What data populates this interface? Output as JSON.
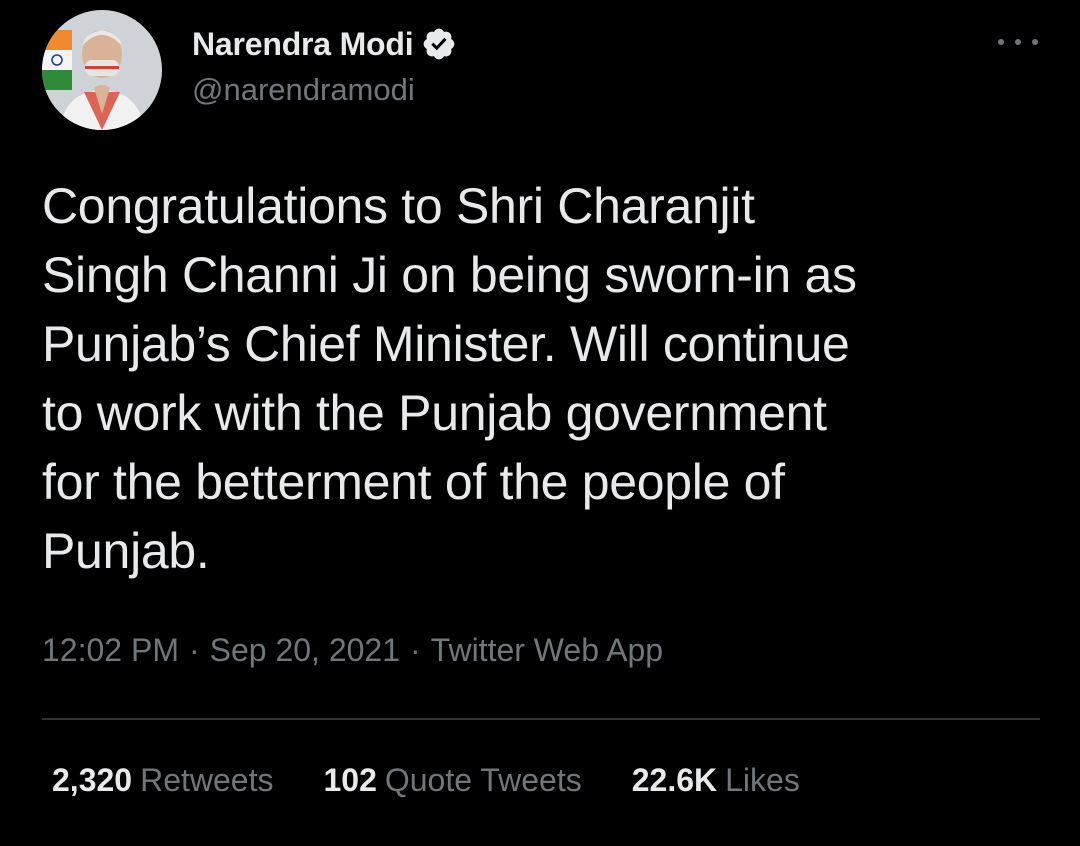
{
  "author": {
    "display_name": "Narendra Modi",
    "handle": "@narendramodi",
    "verified_icon": "verified-badge-icon",
    "avatar": "profile-photo"
  },
  "menu": {
    "icon": "more-options-icon"
  },
  "tweet": {
    "text": "Congratulations to Shri Charanjit\nSingh Channi Ji on being sworn-in as\nPunjab’s Chief Minister. Will continue\nto work with the Punjab government\nfor the betterment of the people of\nPunjab."
  },
  "meta": {
    "time": "12:02 PM",
    "separator": "·",
    "date": "Sep 20, 2021",
    "source": "Twitter Web App"
  },
  "stats": {
    "retweets_count": "2,320",
    "retweets_label": "Retweets",
    "quotes_count": "102",
    "quotes_label": "Quote Tweets",
    "likes_count": "22.6K",
    "likes_label": "Likes"
  },
  "colors": {
    "background": "#000000",
    "primary_text": "#e7e9ea",
    "secondary_text": "#71767b",
    "divider": "#2f3336",
    "verified": "#e7e9ea"
  }
}
